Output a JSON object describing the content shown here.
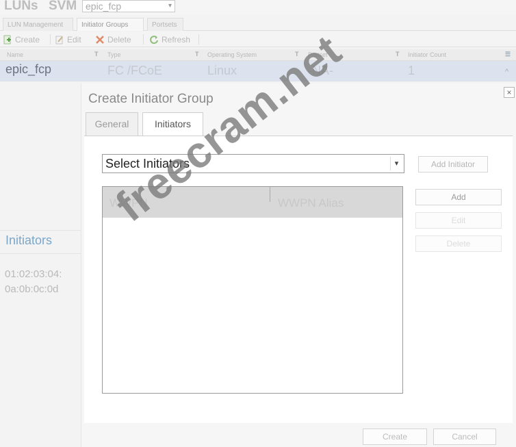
{
  "header": {
    "luns_label": "LUNs",
    "svm_label": "SVM",
    "svm_value": "epic_fcp"
  },
  "tabs": [
    {
      "label": "LUN Management"
    },
    {
      "label": "Initiator Groups"
    },
    {
      "label": "Portsets"
    }
  ],
  "toolbar": {
    "create": "Create",
    "edit": "Edit",
    "delete": "Delete",
    "refresh": "Refresh"
  },
  "grid": {
    "columns": [
      "Name",
      "Type",
      "Operating System",
      "Portset",
      "Initiator Count"
    ],
    "row": {
      "name": "epic_fcp",
      "type": "FC /FCoE",
      "os": "Linux",
      "portset": "-NA-",
      "count": "1"
    }
  },
  "left_panel": {
    "title": "Initiators",
    "values": [
      "01:02:03:04:",
      "0a:0b:0c:0d"
    ]
  },
  "dialog": {
    "title": "Create Initiator Group",
    "close": "×",
    "tabs": {
      "general": "General",
      "initiators": "Initiators"
    },
    "select_initiators": "Select Initiators",
    "add_initiator": "Add Initiator",
    "table_headers": {
      "wwpn": "WWPN",
      "alias": "WWPN Alias"
    },
    "buttons": {
      "add": "Add",
      "edit": "Edit",
      "delete": "Delete",
      "create": "Create",
      "cancel": "Cancel"
    }
  },
  "watermark": "freecram.net",
  "colors": {
    "link_blue": "#7ba7c9",
    "row_selected": "#dde3ee",
    "header_gray": "#d8d8d8"
  }
}
